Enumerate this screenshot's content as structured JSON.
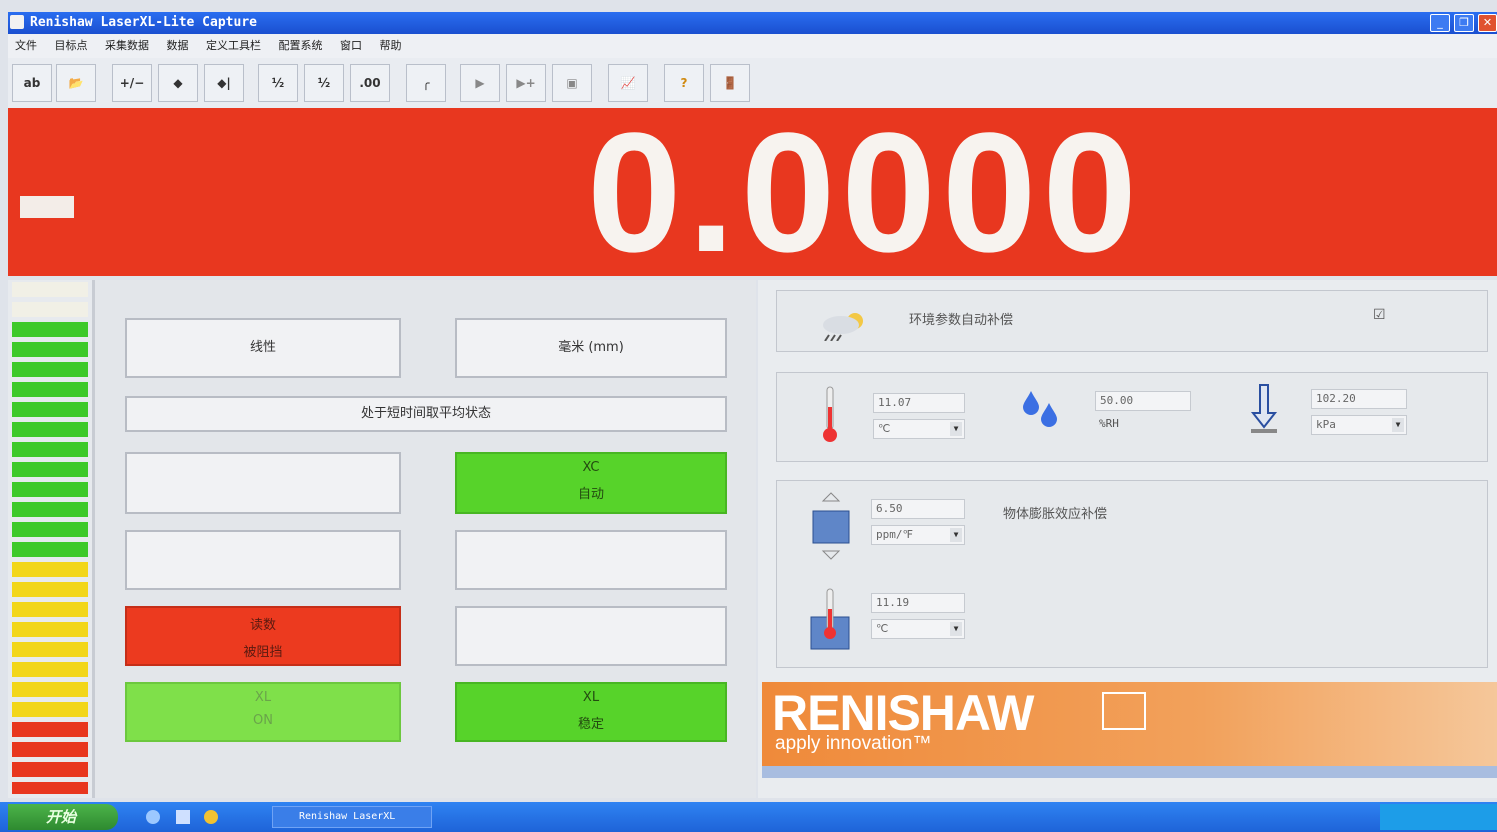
{
  "window": {
    "title": "Renishaw LaserXL-Lite Capture",
    "controls": [
      "_",
      "❐",
      "✕"
    ]
  },
  "menu": [
    "文件",
    "目标点",
    "采集数据",
    "数据",
    "定义工具栏",
    "配置系统",
    "窗口",
    "帮助"
  ],
  "toolbar": {
    "buttons": [
      {
        "icon": "ab-icon",
        "glyph": "ab"
      },
      {
        "icon": "open-folder-icon",
        "glyph": "📂"
      },
      {
        "icon": "plus-minus-icon",
        "glyph": "+/−"
      },
      {
        "icon": "target-datum-icon",
        "glyph": "◆"
      },
      {
        "icon": "target-offset-icon",
        "glyph": "◆|"
      },
      {
        "icon": "resolution-1-icon",
        "glyph": "½"
      },
      {
        "icon": "resolution-2-icon",
        "glyph": "½"
      },
      {
        "icon": "decimal-places-icon",
        "glyph": ".00"
      },
      {
        "icon": "curve-icon",
        "glyph": "╭"
      },
      {
        "icon": "play-icon",
        "glyph": "▶"
      },
      {
        "icon": "play-next-icon",
        "glyph": "▶+"
      },
      {
        "icon": "save-disk-icon",
        "glyph": "▣"
      },
      {
        "icon": "graph-icon",
        "glyph": "📈"
      },
      {
        "icon": "help-icon",
        "glyph": "?"
      },
      {
        "icon": "exit-icon",
        "glyph": "🚪"
      }
    ]
  },
  "readout": {
    "value": "0.0000",
    "background_color": "#e8371f"
  },
  "center": {
    "mode_button": "线性",
    "units_button": "毫米 (mm)",
    "status_text": "处于短时间取平均状态",
    "xc_auto": {
      "line1": "XC",
      "line2": "自动"
    },
    "signal": {
      "line1": "读数",
      "line2": "被阻挡"
    },
    "xl_on": {
      "line1": "XL",
      "line2": "ON"
    },
    "xl_stable": {
      "line1": "XL",
      "line2": "稳定"
    }
  },
  "environment": {
    "auto_comp_label": "环境参数自动补偿",
    "auto_comp_checked": "☑",
    "air_temp": {
      "value": "11.07",
      "unit": "℃"
    },
    "humidity": {
      "value": "50.00",
      "unit": "%RH"
    },
    "pressure": {
      "value": "102.20",
      "unit": "kPa"
    },
    "expansion": {
      "value": "6.50",
      "unit": "ppm/℉",
      "label": "物体膨胀效应补偿"
    },
    "material_temp": {
      "value": "11.19",
      "unit": "℃"
    }
  },
  "logo": {
    "name": "RENISHAW",
    "tagline": "apply innovation™"
  },
  "taskbar": {
    "start_label": "开始",
    "task_label": "Renishaw LaserXL"
  },
  "colors": {
    "green": "#57d32a",
    "red": "#ec3a1f",
    "yellow": "#f2d61a",
    "accent_orange": "#ef8a3a"
  }
}
